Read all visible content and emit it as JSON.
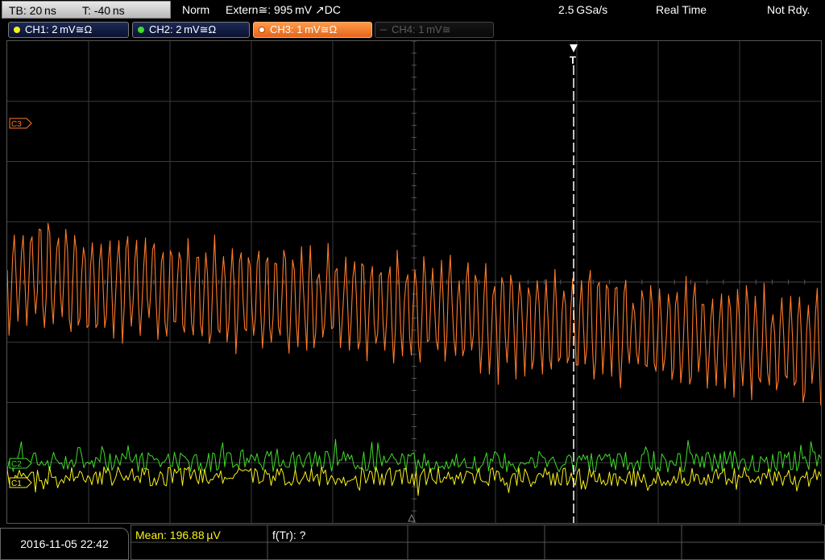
{
  "topbar": {
    "timebase": "TB: 20 ns",
    "trigger_pos": "T: -40 ns",
    "mode": "Norm",
    "trigger": "Extern≅: 995 mV ↗DC",
    "sample_rate": "2.5 GSa/s",
    "acq_mode": "Real Time",
    "status": "Not Rdy."
  },
  "channels": [
    {
      "label": "CH1: 2 mV≅Ω",
      "color": "#f7f21a",
      "state": "on"
    },
    {
      "label": "CH2: 2 mV≅Ω",
      "color": "#3fdc2a",
      "state": "on"
    },
    {
      "label": "CH3: 1 mV≅Ω",
      "color": "#ff7a2a",
      "state": "active"
    },
    {
      "label": "CH4: 1 mV≅",
      "color": "#555555",
      "state": "off"
    }
  ],
  "markers": {
    "ch3": "C3",
    "ch1": "C1",
    "ch2": "C2",
    "trigger": "T"
  },
  "colors": {
    "ch1": "#f7f21a",
    "ch2": "#3fdc2a",
    "ch3": "#ff7a2a",
    "grid": "#3a3a3a"
  },
  "bottom": {
    "datetime": "2016-11-05 22:42",
    "measurement_mean": "Mean: 196.88 µV",
    "measurement_freq": "f(Tr): ?"
  }
}
